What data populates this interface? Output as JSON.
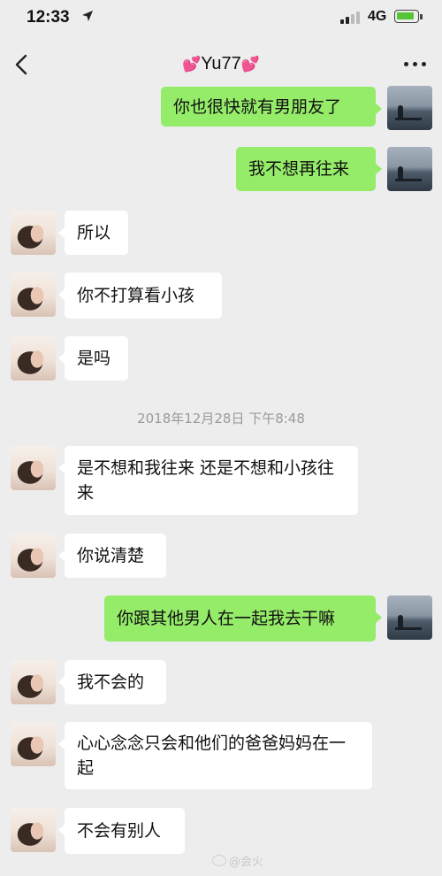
{
  "status_bar": {
    "time": "12:33",
    "network": "4G",
    "battery_charging": true,
    "battery_color": "#56c436"
  },
  "header": {
    "title": "Yu77",
    "title_decoration": "💕",
    "back_icon": "chevron-left-icon",
    "more_icon": "more-dots-icon"
  },
  "messages": [
    {
      "side": "right",
      "text": "你也很快就有男朋友了"
    },
    {
      "side": "right",
      "text": "我不想再往来"
    },
    {
      "side": "left",
      "text": "所以"
    },
    {
      "side": "left",
      "text": "你不打算看小孩"
    },
    {
      "side": "left",
      "text": "是吗"
    },
    {
      "side": "left",
      "text": "是不想和我往来 还是不想和小孩往来"
    },
    {
      "side": "left",
      "text": "你说清楚"
    },
    {
      "side": "right",
      "text": "你跟其他男人在一起我去干嘛"
    },
    {
      "side": "left",
      "text": "我不会的"
    },
    {
      "side": "left",
      "text": "心心念念只会和他们的爸爸妈妈在一起"
    },
    {
      "side": "left",
      "text": "不会有别人"
    }
  ],
  "timestamp": "2018年12月28日 下午8:48",
  "watermark": "@会火",
  "colors": {
    "background": "#ededed",
    "bubble_sent": "#95ec69",
    "bubble_received": "#ffffff",
    "timestamp_text": "#9a9a9a"
  }
}
